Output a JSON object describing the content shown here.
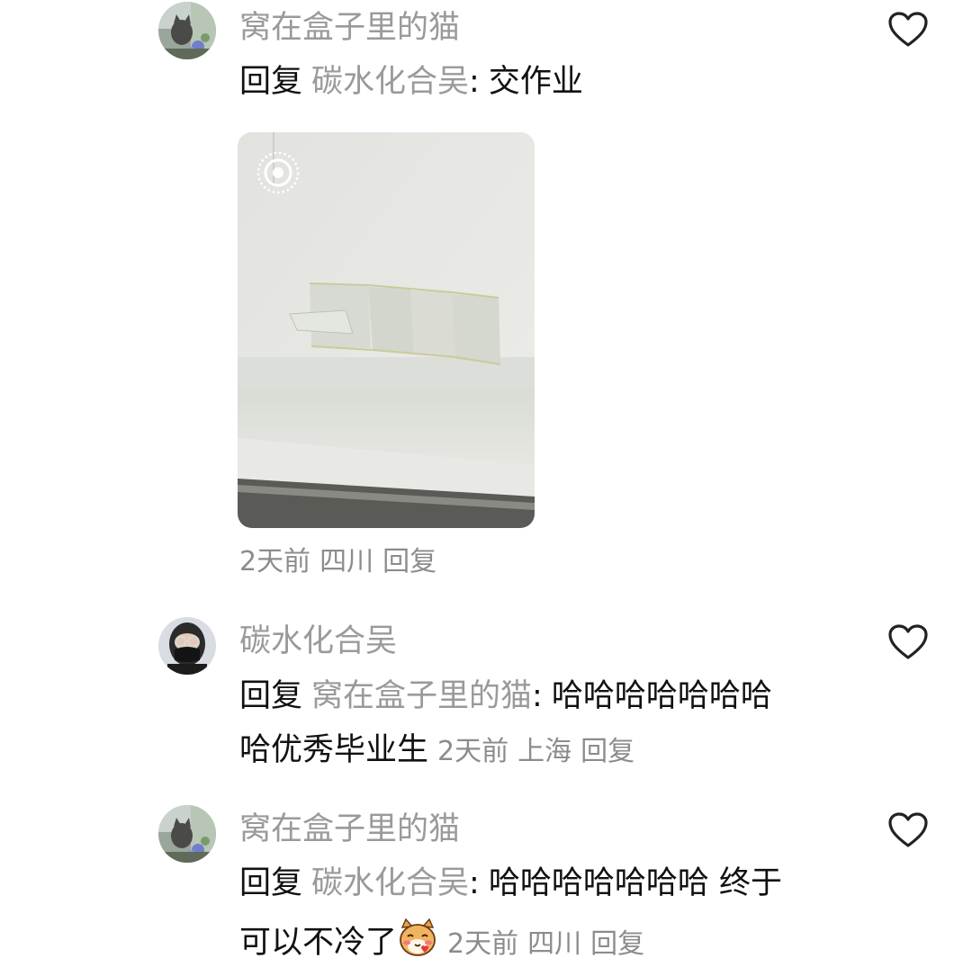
{
  "comments": [
    {
      "username": "窝在盒子里的猫",
      "reply_label": "回复",
      "reply_to": "碳水化合吴",
      "separator": ":",
      "text": "交作业",
      "time": "2天前",
      "location": "四川",
      "reply_action": "回复"
    },
    {
      "username": "碳水化合吴",
      "reply_label": "回复",
      "reply_to": "窝在盒子里的猫",
      "separator": ":",
      "text_line1": "哈哈哈哈哈哈哈",
      "text_line2": "哈优秀毕业生",
      "time": "2天前",
      "location": "上海",
      "reply_action": "回复"
    },
    {
      "username": "窝在盒子里的猫",
      "reply_label": "回复",
      "reply_to": "碳水化合吴",
      "separator": ":",
      "text_line1": "哈哈哈哈哈哈哈 终于",
      "text_line2": "可以不冷了",
      "time": "2天前",
      "location": "四川",
      "reply_action": "回复"
    }
  ],
  "icons": {
    "like": "heart-outline-icon",
    "live_photo": "live-photo-icon",
    "emoji": "cat-blush-emoji"
  },
  "colors": {
    "username": "#9a9a9a",
    "text": "#111111",
    "meta": "#8c8c8c"
  }
}
